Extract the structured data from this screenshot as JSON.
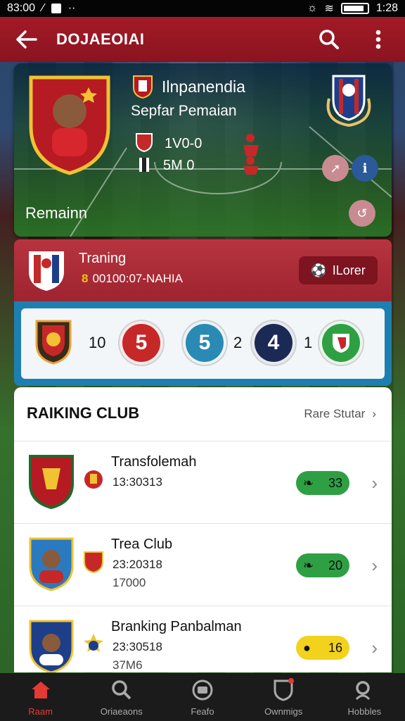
{
  "status_bar": {
    "time_left": "83:00",
    "time_right": "1:28"
  },
  "app_bar": {
    "title": "DOJAEOIAI"
  },
  "hero": {
    "title": "Ilnpanendia",
    "subtitle": "Sepfar Pemaian",
    "score_line1": "1V0-0",
    "score_line2": "5M 0",
    "label": "Remainn"
  },
  "training": {
    "title": "Traning",
    "time": "00100:07-NAHIA",
    "button_label": "ILorer"
  },
  "score_row": {
    "left_number": "10",
    "circle1": "5",
    "circle2": "5",
    "mid_number": "2",
    "circle3": "4",
    "right_number": "1"
  },
  "ranking": {
    "title": "RAIKING CLUB",
    "link_label": "Rare Stutar",
    "items": [
      {
        "name": "Transfolemah",
        "line2": "13:30313",
        "line3": "",
        "score": "33",
        "pill_color": "#2ea043"
      },
      {
        "name": "Trea Club",
        "line2": "23:20318",
        "line3": "17000",
        "score": "20",
        "pill_color": "#2ea043"
      },
      {
        "name": "Branking Panbalman",
        "line2": "23:30518",
        "line3": "37M6",
        "score": "16",
        "pill_color": "#f2d21c"
      }
    ]
  },
  "bottom_nav": [
    {
      "label": "Raam",
      "icon": "home-icon"
    },
    {
      "label": "Oriaeaons",
      "icon": "search-icon"
    },
    {
      "label": "Feafo",
      "icon": "ball-icon"
    },
    {
      "label": "Ownmigs",
      "icon": "shield-icon"
    },
    {
      "label": "Hobbles",
      "icon": "search-icon"
    }
  ]
}
